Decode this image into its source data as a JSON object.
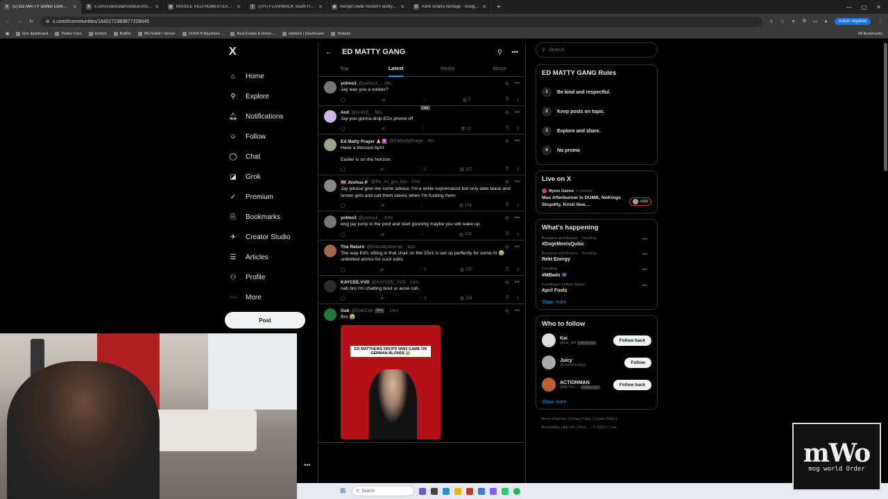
{
  "browser": {
    "tabs": [
      {
        "title": "(1) ED MATTY GANG Community",
        "active": true,
        "fav": "X"
      },
      {
        "title": "x.com/Clavicular0/status/2039…",
        "active": false,
        "fav": "X"
      },
      {
        "title": "MISSILE SILO HOMESTEAD - G…",
        "active": false,
        "fav": "◍"
      },
      {
        "title": "(20+) FLASHBACK South Florid…",
        "active": false,
        "fav": "f"
      },
      {
        "title": "Aerojet Dade Rocket Facility | d…",
        "active": false,
        "fav": "◈"
      },
      {
        "title": "frank sinatra heritage - Google…",
        "active": false,
        "fav": "G"
      }
    ],
    "url": "x.com/i/communities/1845272383877226645",
    "action_required": "Action required",
    "bookmarks": [
      "kick dashboard",
      "Twitter Com",
      "kickbot",
      "BotRix",
      "IRLToolkit • Server",
      "11404 N Bayshore…",
      "Real Estate & Home…",
      "sidekick | Dashboard",
      "Youtube"
    ],
    "all_bookmarks": "All Bookmarks"
  },
  "nav": {
    "logo": "X",
    "items": [
      {
        "label": "Home",
        "icon": "⌂"
      },
      {
        "label": "Explore",
        "icon": "⚲"
      },
      {
        "label": "Notifications",
        "icon": "🔔︎"
      },
      {
        "label": "Follow",
        "icon": "☺"
      },
      {
        "label": "Chat",
        "icon": "◯"
      },
      {
        "label": "Grok",
        "icon": "◪"
      },
      {
        "label": "Premium",
        "icon": "✓"
      },
      {
        "label": "Bookmarks",
        "icon": "⎘"
      },
      {
        "label": "Creator Studio",
        "icon": "✈"
      },
      {
        "label": "Articles",
        "icon": "☰"
      },
      {
        "label": "Profile",
        "icon": "⚇"
      },
      {
        "label": "More",
        "icon": "⋯"
      }
    ],
    "post_label": "Post"
  },
  "community": {
    "title": "ED MATTY GANG",
    "tabs": [
      "Top",
      "Latest",
      "Media",
      "About"
    ],
    "active_tab": "Latest",
    "tooltip": "Like",
    "tweets": [
      {
        "name": "yolmo3",
        "handle": "@yolmo3_ · 36s",
        "text": "Jay was you a soldier?",
        "replies": "",
        "retweets": "",
        "likes": "",
        "views": "2",
        "avatar": "#777",
        "text2": ""
      },
      {
        "name": "Anil",
        "handle": "@Anil18_ · 58s",
        "text": "Jay you gonna drop EDs phone off",
        "replies": "",
        "retweets": "",
        "likes": "",
        "views": "12",
        "avatar": "#c8b8e8",
        "text2": ""
      },
      {
        "name": "Ed Matty Prayer 🙏🏻✝️",
        "handle": "@EdMattyPrayer · 9m",
        "text": "Have a blessed April.",
        "replies": "",
        "retweets": "",
        "likes": "1",
        "views": "107",
        "avatar": "#9aa88a",
        "text2": "Easter is on the horizon."
      },
      {
        "name": "🇬🇧 Joshua⚡",
        "handle": "@Re_ml_gra_tion · 10m",
        "text": "Jay please give me some advice, I'm a white supremacist but only date black and brown girls and call them slaves when I'm fucking them",
        "replies": "",
        "retweets": "",
        "likes": "",
        "views": "108",
        "avatar": "#888",
        "text2": ""
      },
      {
        "name": "yolmo3",
        "handle": "@yolmo3_ · 10m",
        "text": "wsg jay jump in the pool and start gooning maybe you will wake up",
        "replies": "",
        "retweets": "",
        "likes": "",
        "views": "109",
        "avatar": "#777",
        "text2": ""
      },
      {
        "name": "The Return",
        "handle": "@Edmattysburner · 11m",
        "text": "The way Ed's sitting in that chair on the 20v1 is set up perfectly for some AI 😭 unlimited ammo for cuck edits",
        "replies": "",
        "retweets": "",
        "likes": "1",
        "views": "120",
        "avatar": "#a06a4a",
        "text2": ""
      },
      {
        "name": "KAYCEE.VVD",
        "handle": "@KAYCEE_VVD · 13m",
        "text": "nah bro I'm chatting bout ur acne cuh.",
        "replies": "",
        "retweets": "",
        "likes": "3",
        "views": "124",
        "avatar": "#2a2a2a",
        "text2": ""
      }
    ],
    "media_tweet": {
      "name": "Gab",
      "handle": "@GabCuh",
      "mod": "Mod",
      "time": "· 14m",
      "text": "Bro 😭",
      "caption": "ED MATTHEWS DROPS WW2 GAME ON GERMAN BLONDE 😭"
    }
  },
  "sidebar": {
    "search_placeholder": "Search",
    "rules_title": "ED MATTY GANG Rules",
    "rules": [
      {
        "n": "1",
        "text": "Be kind and respectful."
      },
      {
        "n": "2",
        "text": "Keep posts on topic."
      },
      {
        "n": "3",
        "text": "Explore and share."
      },
      {
        "n": "4",
        "text": "No promo"
      }
    ],
    "live_title": "Live on X",
    "live_host": "Myron Gaines",
    "live_hosting": "is hosting",
    "live_text": "Max Afterburner Is DUMB, NoKings Stupdity, Kristi Noe…",
    "live_count": "+559",
    "happening_title": "What's happening",
    "trends": [
      {
        "cat": "Business and finance · Trending",
        "topic": "#DogeMeetsQubic"
      },
      {
        "cat": "Business and finance · Trending",
        "topic": "Rekt Energy"
      },
      {
        "cat": "Trending",
        "topic": "#MBwin 👾"
      },
      {
        "cat": "Trending in United States",
        "topic": "April Fools"
      }
    ],
    "show_more": "Show more",
    "wtf_title": "Who to follow",
    "who_to_follow": [
      {
        "name": "Kai",
        "handle": "@kai_xbt",
        "follows_you": "Follows you",
        "button": "Follow back",
        "avatar": "#ddd"
      },
      {
        "name": "Juicy",
        "handle": "@JuicyFruityyy",
        "follows_you": "",
        "button": "Follow",
        "avatar": "#aaa"
      },
      {
        "name": "ACTIONMAN",
        "handle": "@Ac7ion…",
        "follows_you": "Follows you",
        "button": "Follow back",
        "avatar": "#c06030"
      }
    ],
    "footer1": "Terms of Service  |  Privacy Policy  |  Cookie Policy  |",
    "footer2": "Accessibility  |  Ads info  |  More …  |  © 2026 X Corp."
  },
  "taskbar": {
    "search": "Search"
  },
  "overlay": {
    "logo_big": "mWo",
    "logo_small": "mog world Order"
  }
}
